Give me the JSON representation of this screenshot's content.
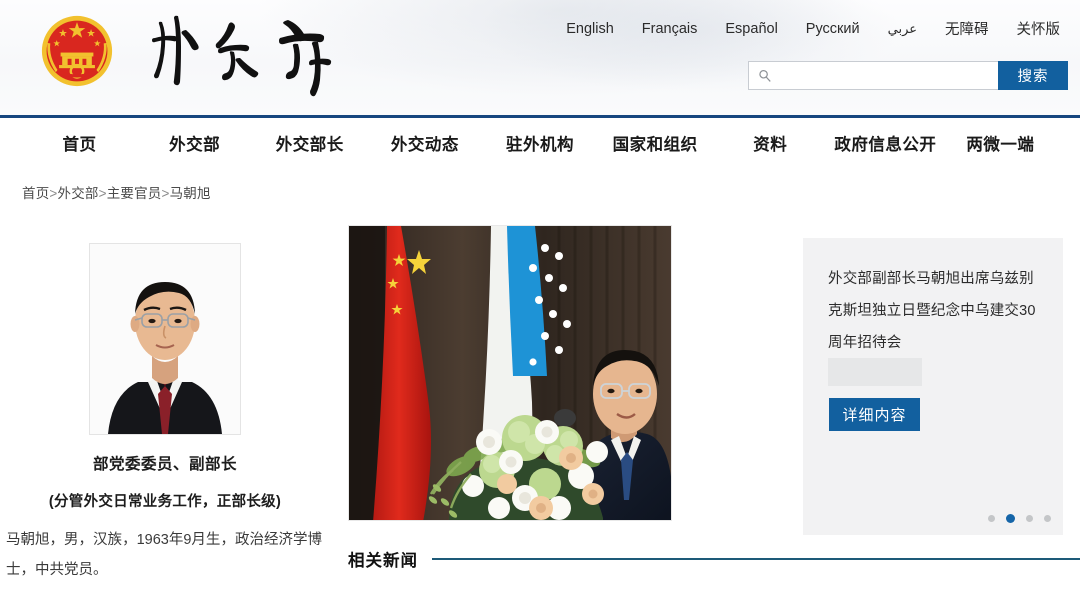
{
  "header": {
    "emblem_icon": "china-national-emblem",
    "site_logo_text": "外交部",
    "languages": [
      {
        "label": "English",
        "kind": "latin"
      },
      {
        "label": "Français",
        "kind": "latin"
      },
      {
        "label": "Español",
        "kind": "latin"
      },
      {
        "label": "Русский",
        "kind": "latin"
      },
      {
        "label": "عربي",
        "kind": "arabic"
      },
      {
        "label": "无障碍",
        "kind": "cn"
      },
      {
        "label": "关怀版",
        "kind": "cn"
      }
    ],
    "search": {
      "placeholder": "",
      "value": "",
      "button_label": "搜索",
      "icon": "search-icon"
    }
  },
  "nav": {
    "items": [
      "首页",
      "外交部",
      "外交部长",
      "外交动态",
      "驻外机构",
      "国家和组织",
      "资料",
      "政府信息公开",
      "两微一端"
    ]
  },
  "breadcrumb": {
    "items": [
      "首页",
      "外交部",
      "主要官员",
      "马朝旭"
    ],
    "separator": ">"
  },
  "profile": {
    "portrait_alt": "马朝旭 官方肖像照",
    "title_line1": "部党委委员、副部长",
    "title_line2": "(分管外交日常业务工作，正部长级)",
    "bio": "马朝旭，男，汉族，1963年9月生，政治经济学博士，中共党员。"
  },
  "feature": {
    "photo_alt": "马朝旭出席招待会并讲话，背景为中国国旗与乌兹别克斯坦国旗",
    "related_news_title": "相关新闻"
  },
  "promo": {
    "headline": "外交部副部长马朝旭出席乌兹别克斯坦独立日暨纪念中乌建交30周年招待会",
    "button_label": "详细内容",
    "carousel": {
      "count": 4,
      "active_index": 1
    }
  },
  "colors": {
    "nav_border": "#16477f",
    "accent_blue": "#12609f",
    "dot_active": "#1565a8",
    "dot_inactive": "#c4c6c8",
    "rel_line": "#1d5a78",
    "panel_bg": "#f2f2f3"
  }
}
